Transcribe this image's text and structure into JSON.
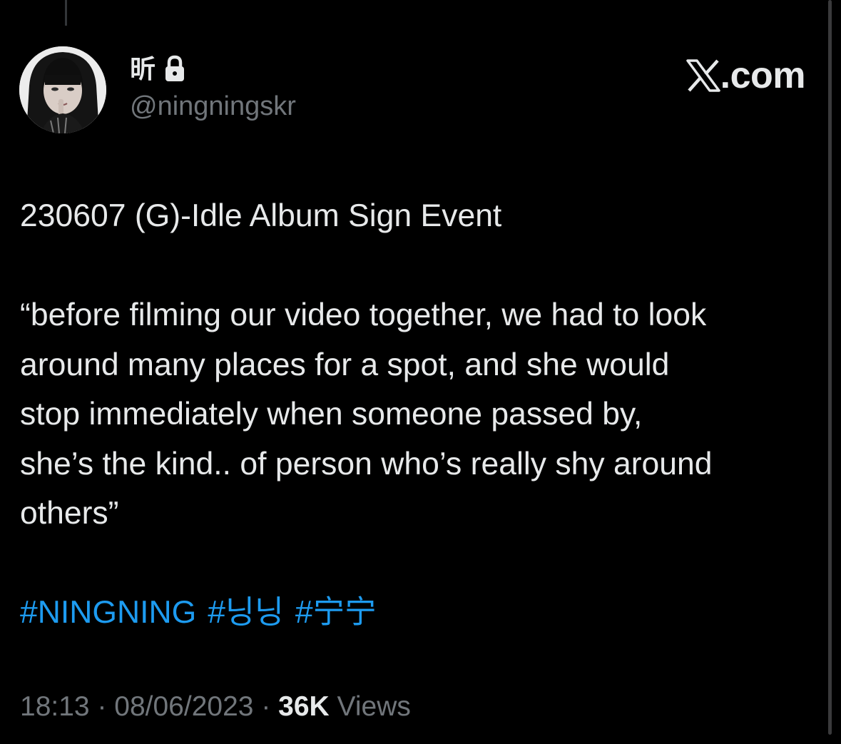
{
  "author": {
    "display_name": "昕",
    "handle": "@ningningskr",
    "lock_icon": "lock-icon"
  },
  "brand": {
    "logo_icon": "x-logo-icon",
    "text": ".com"
  },
  "tweet": {
    "line1": "230607 (G)-Idle Album Sign Event",
    "quote_lines": [
      "“before filming our video together, we had to look",
      "around many places for a spot, and she would",
      "stop immediately when someone passed by,",
      "she’s the kind.. of person who’s really shy around",
      "others”"
    ],
    "hashtags": [
      "#NINGNING",
      "#닝닝",
      "#宁宁"
    ]
  },
  "meta": {
    "time": "18:13",
    "sep1": " · ",
    "date": "08/06/2023",
    "sep2": " · ",
    "views_count": "36K",
    "views_label": " Views"
  },
  "colors": {
    "background": "#000000",
    "text": "#e7e9ea",
    "secondary": "#71767b",
    "link": "#1d9bf0"
  }
}
